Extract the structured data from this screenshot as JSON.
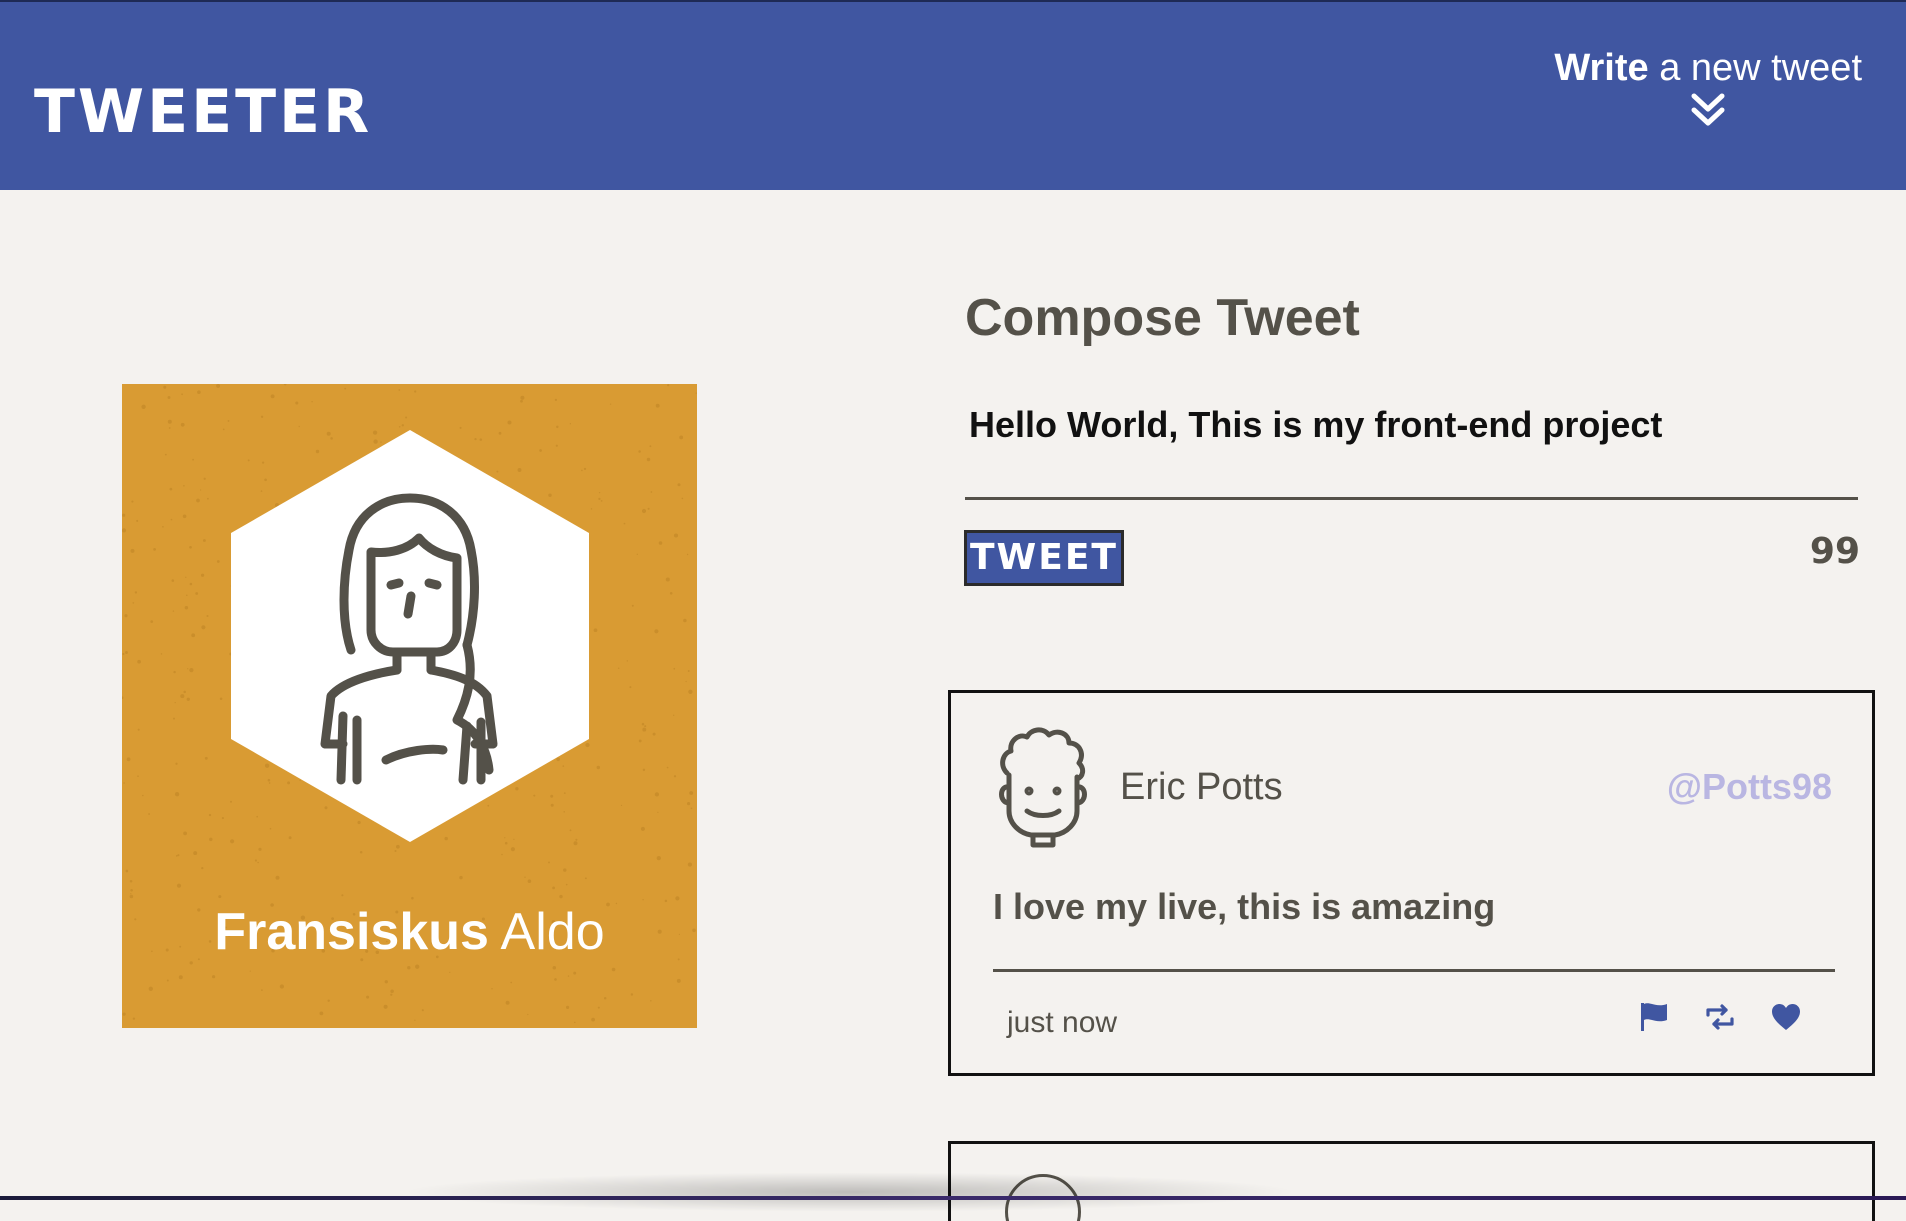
{
  "nav": {
    "brand": "TWEETER",
    "write_bold": "Write",
    "write_rest": " a new tweet",
    "toggle_icon": "double-chevron-down-icon"
  },
  "profile": {
    "first_name": "Fransiskus",
    "last_name": " Aldo",
    "avatar_icon": "girl-avatar-icon",
    "background_color": "#d99b33"
  },
  "compose": {
    "title": "Compose Tweet",
    "text_value": "Hello World, This is my front-end project",
    "button_label": "TWEET",
    "counter": "99"
  },
  "tweets": [
    {
      "name": "Eric Potts",
      "handle": "@Potts98",
      "body": "I love my live, this is amazing",
      "time": "just now",
      "actions": [
        "flag-icon",
        "retweet-icon",
        "heart-icon"
      ]
    }
  ],
  "colors": {
    "nav": "#4056a1",
    "background": "#f4f2ef",
    "text": "#545149",
    "handle": "#b9b6e2"
  }
}
